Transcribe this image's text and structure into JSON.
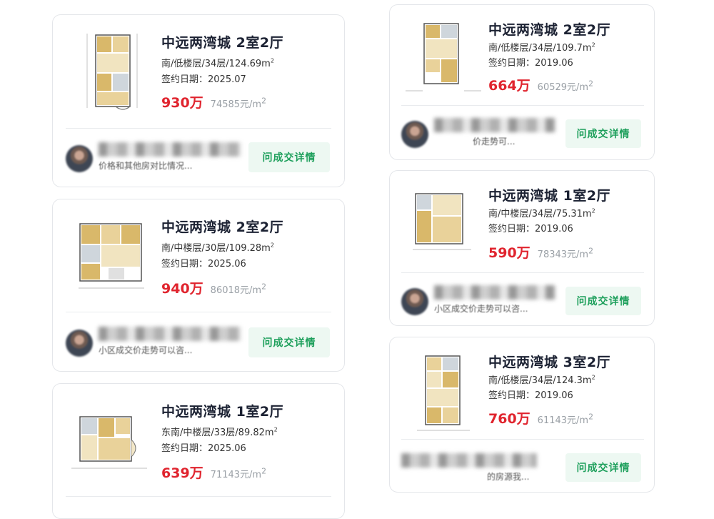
{
  "listings": [
    {
      "title": "中远两湾城 2室2厅",
      "meta": "南/低楼层/34层/124.69",
      "sign_label": "签约日期：",
      "sign_date": "2025.07",
      "price": "930万",
      "unit_price": "74585元/",
      "agent_text": "价格和其他房对比情况...",
      "button": "问成交详情"
    },
    {
      "title": "中远两湾城 2室2厅",
      "meta": "南/中楼层/30层/109.28",
      "sign_label": "签约日期：",
      "sign_date": "2025.06",
      "price": "940万",
      "unit_price": "86018元/",
      "agent_text": "小区成交价走势可以咨...",
      "button": "问成交详情"
    },
    {
      "title": "中远两湾城 1室2厅",
      "meta": "东南/中楼层/33层/89.82",
      "sign_label": "签约日期：",
      "sign_date": "2025.06",
      "price": "639万",
      "unit_price": "71143元/"
    },
    {
      "title": "中远两湾城 2室2厅",
      "meta": "南/低楼层/34层/109.7",
      "sign_label": "签约日期：",
      "sign_date": "2019.06",
      "price": "664万",
      "unit_price": "60529元/",
      "agent_text": "价走势可...",
      "button": "问成交详情"
    },
    {
      "title": "中远两湾城 1室2厅",
      "meta": "南/中楼层/34层/75.31",
      "sign_label": "签约日期：",
      "sign_date": "2019.06",
      "price": "590万",
      "unit_price": "78343元/",
      "agent_text": "小区成交价走势可以咨...",
      "button": "问成交详情"
    },
    {
      "title": "中远两湾城 3室2厅",
      "meta": "南/低楼层/34层/124.3",
      "sign_label": "签约日期：",
      "sign_date": "2019.06",
      "price": "760万",
      "unit_price": "61143元/",
      "agent_text": "的房源我...",
      "button": "问成交详情"
    }
  ],
  "area_unit": "m",
  "area_sup": "2",
  "colors": {
    "price": "#e0242e",
    "button_text": "#1d9f5b",
    "button_bg": "#edf8f2"
  }
}
